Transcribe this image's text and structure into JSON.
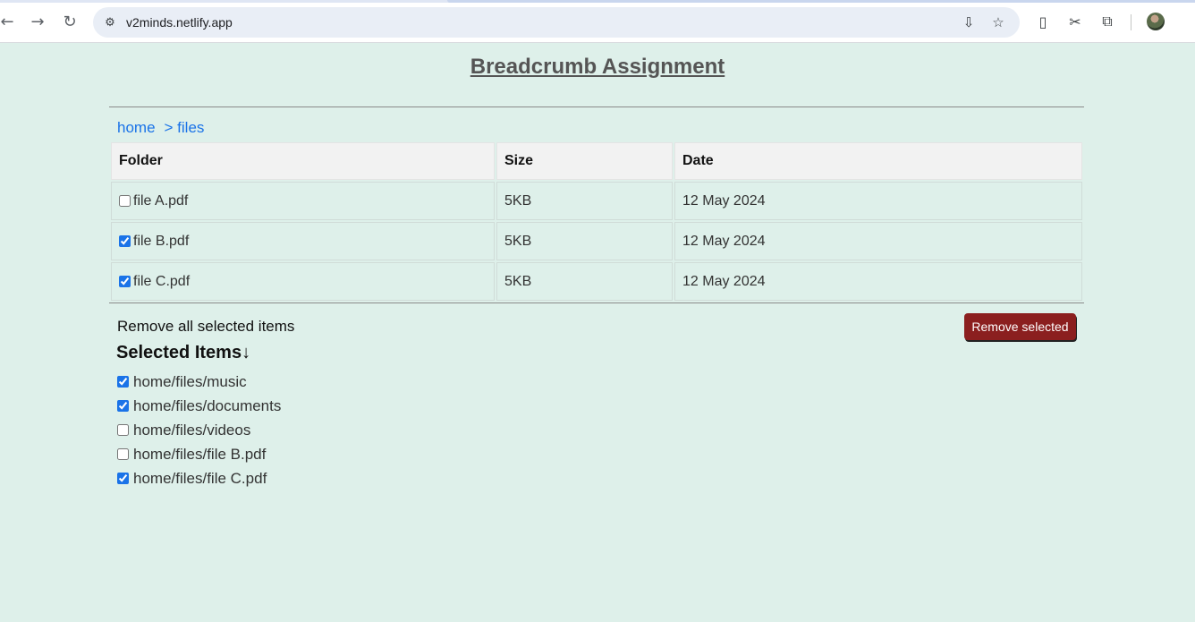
{
  "browser": {
    "url": "v2minds.netlify.app",
    "icons": [
      "back-arrow-icon",
      "forward-arrow-icon",
      "reload-icon",
      "site-info-icon",
      "install-app-icon",
      "star-icon",
      "extension-badge-icon",
      "extension-icon",
      "puzzle-icon",
      "profile-avatar"
    ]
  },
  "page": {
    "title": "Breadcrumb Assignment",
    "breadcrumb": [
      "home",
      "> files"
    ],
    "table": {
      "headers": [
        "Folder",
        "Size",
        "Date"
      ],
      "rows": [
        {
          "name": "file A.pdf",
          "size": "5KB",
          "date": "12 May 2024",
          "checked": false
        },
        {
          "name": "file B.pdf",
          "size": "5KB",
          "date": "12 May 2024",
          "checked": true
        },
        {
          "name": "file C.pdf",
          "size": "5KB",
          "date": "12 May 2024",
          "checked": true
        }
      ]
    },
    "remove_text": "Remove all selected items",
    "remove_button": "Remove selected",
    "selected_heading": "Selected Items↓",
    "selected_items": [
      {
        "path": "home/files/music",
        "checked": true
      },
      {
        "path": "home/files/documents",
        "checked": true
      },
      {
        "path": "home/files/videos",
        "checked": false
      },
      {
        "path": "home/files/file B.pdf",
        "checked": false
      },
      {
        "path": "home/files/file C.pdf",
        "checked": true
      }
    ],
    "colors": {
      "background": "#def0ea",
      "link": "#1a73e8",
      "button": "#8b1f1f"
    }
  }
}
